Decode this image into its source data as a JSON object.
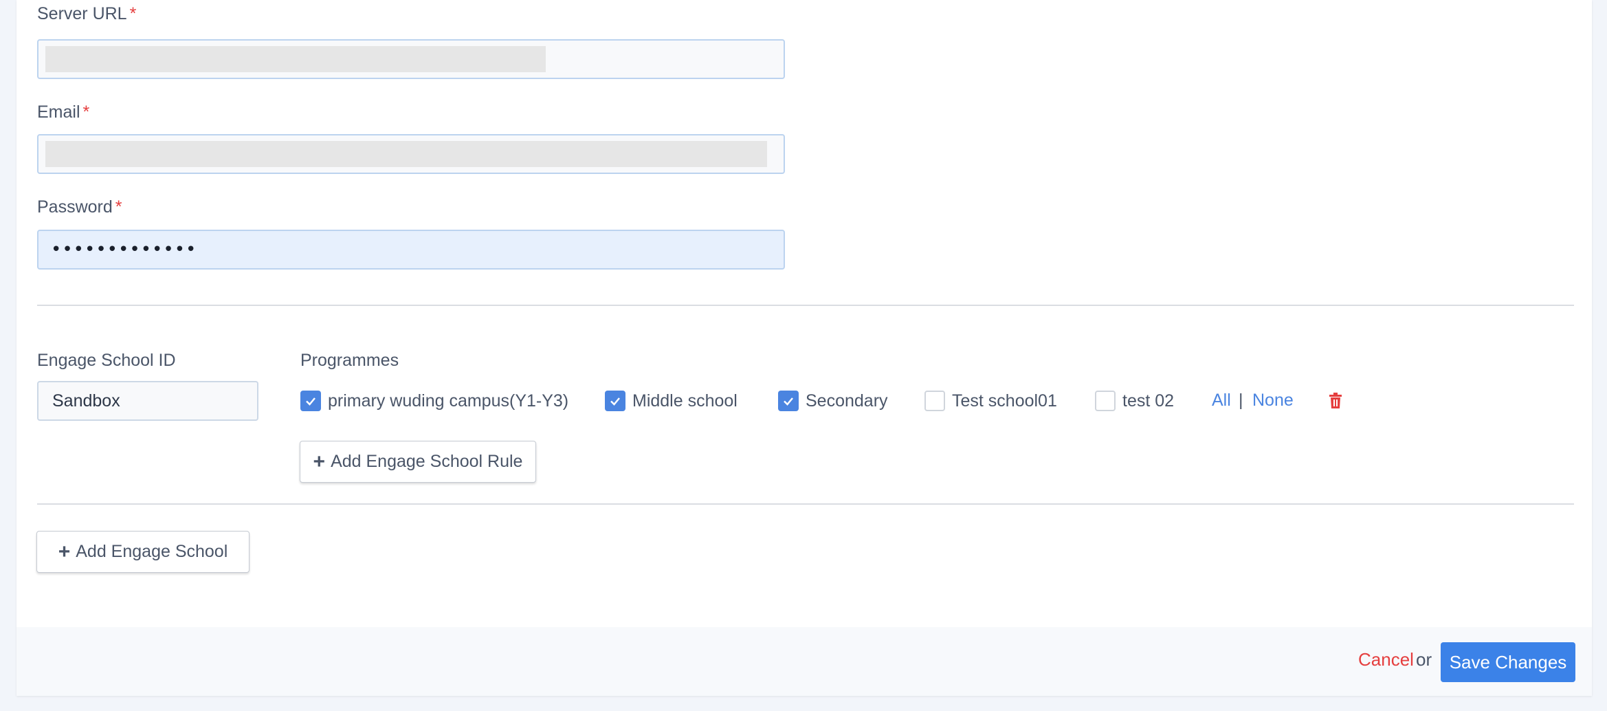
{
  "form": {
    "server_url": {
      "label": "Server URL",
      "required_mark": "*",
      "value": ""
    },
    "email": {
      "label": "Email",
      "required_mark": "*",
      "value": ""
    },
    "password": {
      "label": "Password",
      "required_mark": "*",
      "value": "•••••••••••••"
    }
  },
  "engage": {
    "school_id_label": "Engage School ID",
    "school_id_value": "Sandbox",
    "programmes_label": "Programmes",
    "programmes": [
      {
        "label": "primary wuding campus(Y1-Y3)",
        "checked": true
      },
      {
        "label": "Middle school",
        "checked": true
      },
      {
        "label": "Secondary",
        "checked": true
      },
      {
        "label": "Test school01",
        "checked": false
      },
      {
        "label": "test 02",
        "checked": false
      }
    ],
    "select_all": "All",
    "separator": "|",
    "select_none": "None",
    "delete_icon": "trash-icon",
    "add_rule_label": "Add Engage School Rule",
    "add_school_label": "Add Engage School"
  },
  "footer": {
    "cancel": "Cancel",
    "or": "or",
    "save": "Save Changes"
  },
  "colors": {
    "accent": "#3b82e8",
    "danger": "#e53e3e",
    "checkbox_on": "#4a84e0"
  }
}
